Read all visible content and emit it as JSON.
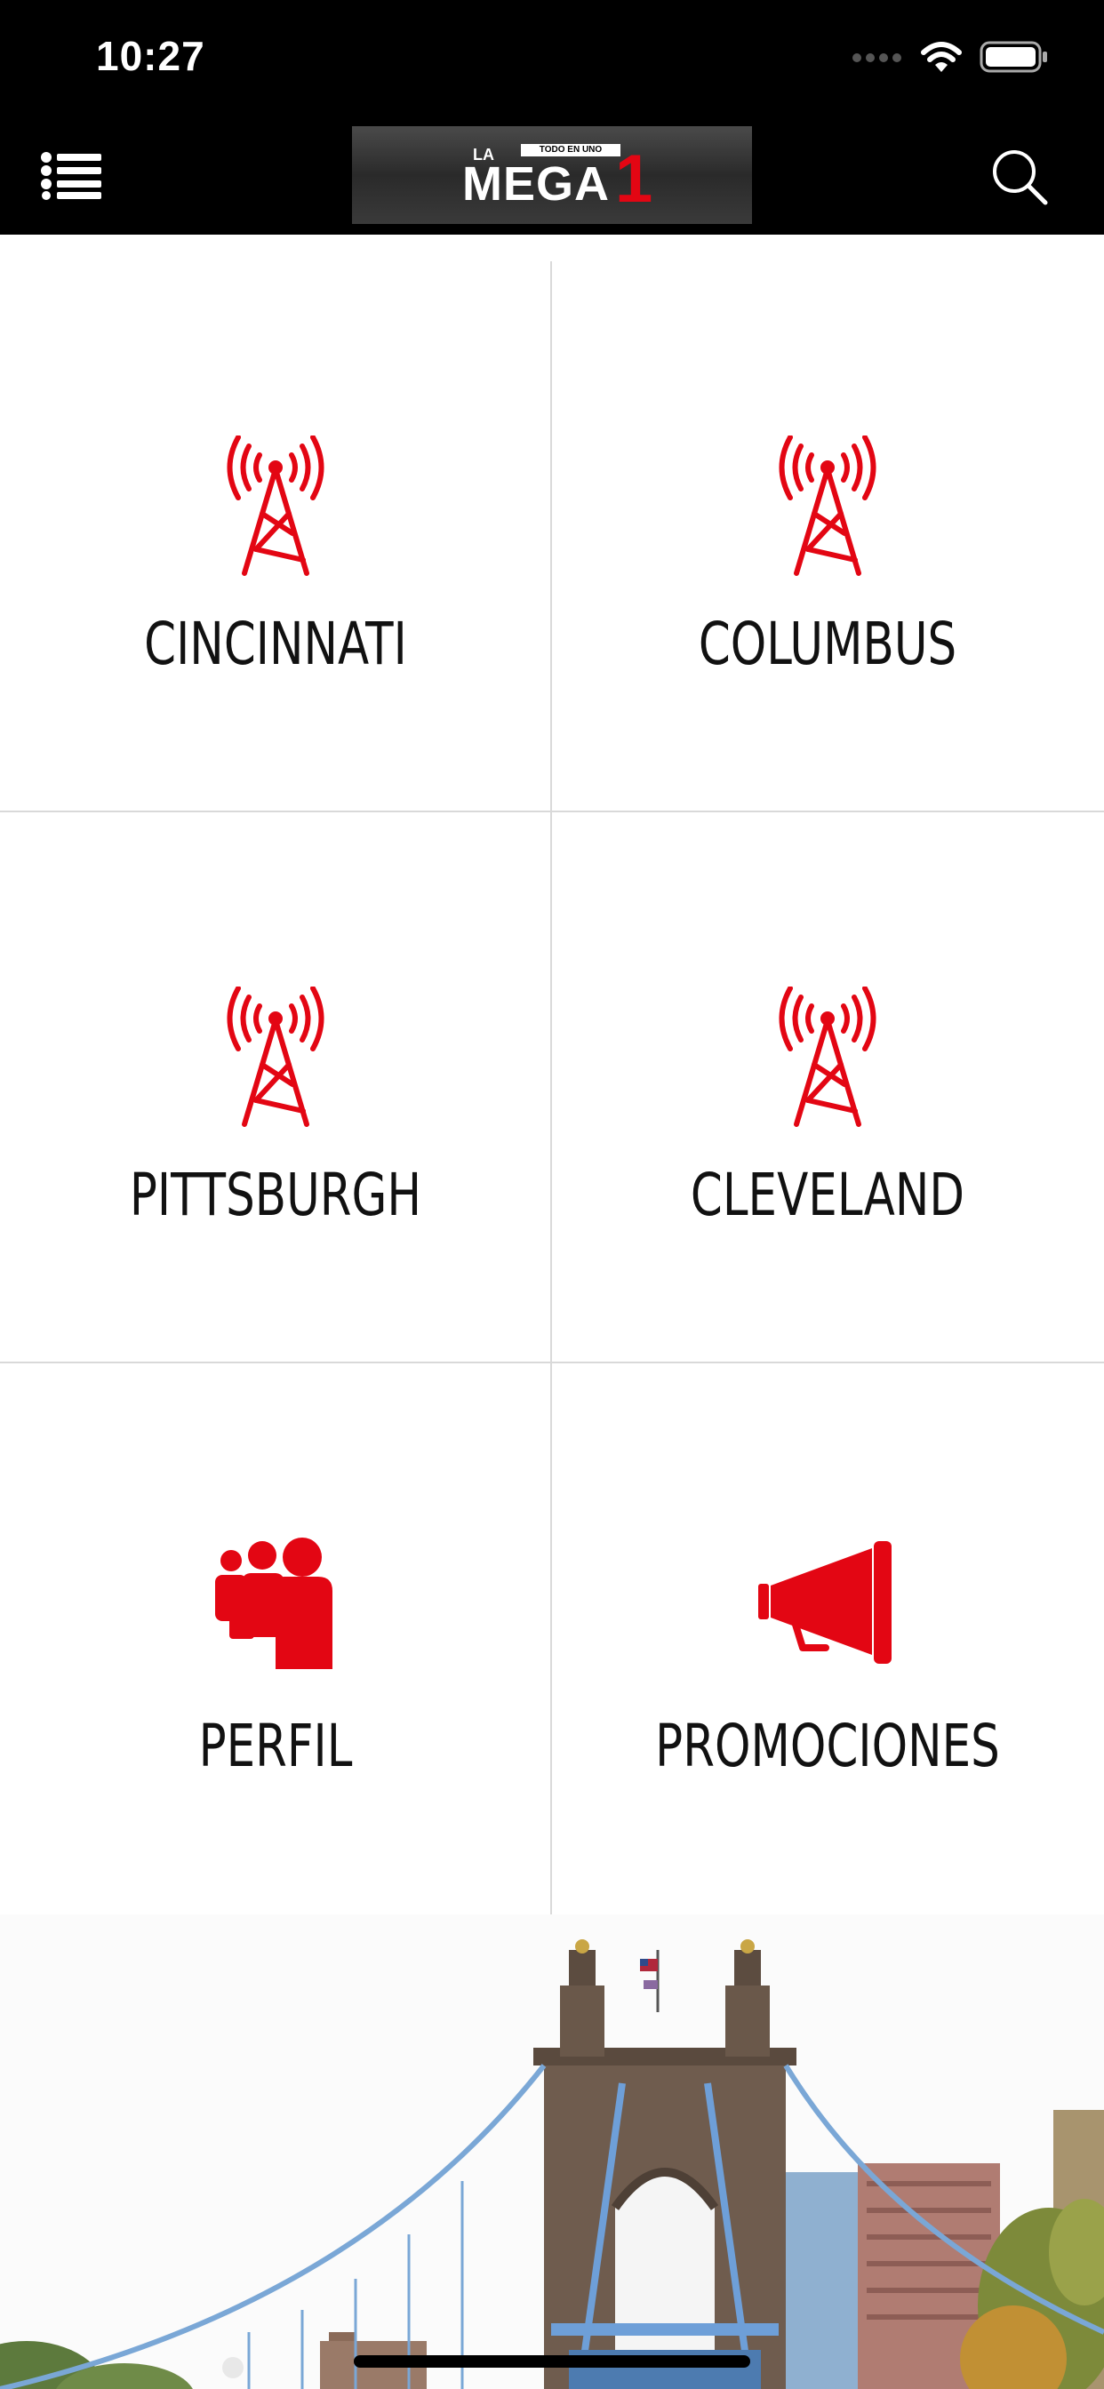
{
  "status_bar": {
    "time": "10:27"
  },
  "header": {
    "logo": {
      "prefix": "LA",
      "tagline": "TODO EN UNO",
      "name": "MEGA",
      "number": "1"
    },
    "menu_icon": "list-menu-icon",
    "search_icon": "search-icon"
  },
  "tiles": [
    {
      "label": "CINCINNATI",
      "icon": "radio-tower-icon"
    },
    {
      "label": "COLUMBUS",
      "icon": "radio-tower-icon"
    },
    {
      "label": "PITTSBURGH",
      "icon": "radio-tower-icon"
    },
    {
      "label": "CLEVELAND",
      "icon": "radio-tower-icon"
    },
    {
      "label": "PERFIL",
      "icon": "people-group-icon"
    },
    {
      "label": "PROMOCIONES",
      "icon": "megaphone-icon"
    }
  ],
  "colors": {
    "accent": "#e30613",
    "header_bg": "#000000",
    "divider": "#d9d9d9",
    "label_text": "#111111"
  },
  "footer_image": "cincinnati-suspension-bridge-photo"
}
